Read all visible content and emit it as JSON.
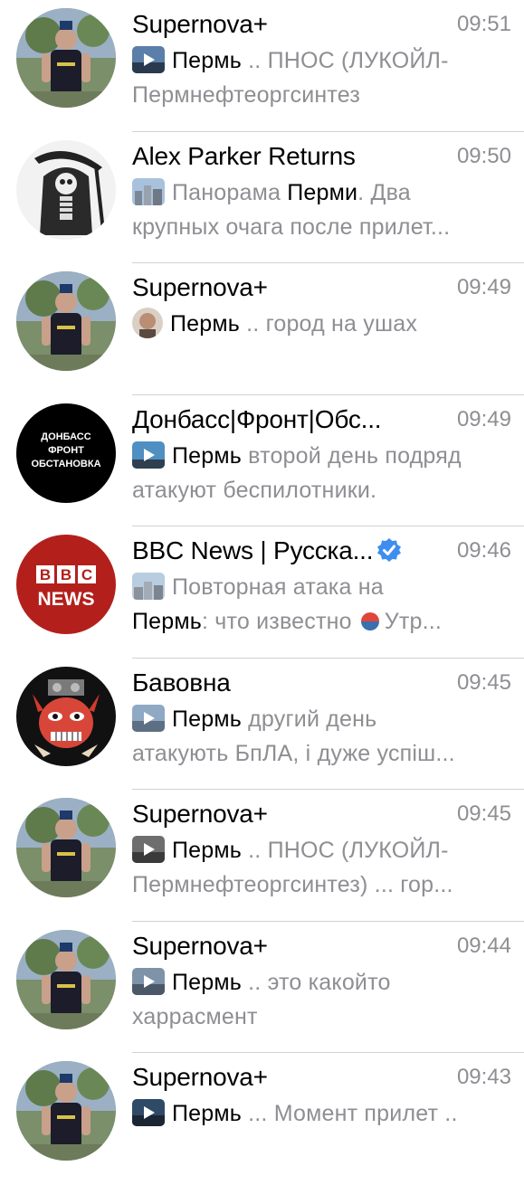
{
  "chats": [
    {
      "name": "Supernova+",
      "time": "09:51",
      "keyword": "Пермь",
      "pre": "",
      "after": " .. ПНОС (ЛУКОЙЛ-",
      "line2": "Пермнефтеоргсинтез",
      "avatar": "person",
      "thumb": "video"
    },
    {
      "name": "Alex Parker Returns",
      "time": "09:50",
      "keyword": "Перми",
      "pre": "Панорама ",
      "after": ". Два",
      "line2": "крупных очага после прилет...",
      "avatar": "reaper",
      "thumb": "city"
    },
    {
      "name": "Supernova+",
      "time": "09:49",
      "keyword": "Пермь",
      "pre": "",
      "after": " .. город на ушах",
      "line2": "",
      "avatar": "person",
      "thumb": "face"
    },
    {
      "name": "Донбасс|Фронт|Обс...",
      "time": "09:49",
      "keyword": "Пермь",
      "pre": "",
      "after": " второй день подряд",
      "line2": "атакуют беспилотники.",
      "avatar": "donbass",
      "thumb": "video"
    },
    {
      "name": "BBC News | Русска...",
      "time": "09:46",
      "keyword": "Пермь",
      "pre": "",
      "after": "",
      "line1": "Повторная атака на",
      "line2_after": ": что известно",
      "line2_tail": "Утр...",
      "verified": true,
      "avatar": "bbc",
      "thumb": "city"
    },
    {
      "name": "Бавовна",
      "time": "09:45",
      "keyword": "Пермь",
      "pre": "",
      "after": " другий день",
      "line2": "атакують БпЛА, і дуже успіш...",
      "avatar": "mask",
      "thumb": "video"
    },
    {
      "name": "Supernova+",
      "time": "09:45",
      "keyword": "Пермь",
      "pre": "",
      "after": " .. ПНОС (ЛУКОЙЛ-",
      "line2": "Пермнефтеоргсинтез) ... гор...",
      "avatar": "person",
      "thumb": "video"
    },
    {
      "name": "Supernova+",
      "time": "09:44",
      "keyword": "Пермь",
      "pre": "",
      "after": " .. это какойто",
      "line2": "харрасмент",
      "avatar": "person",
      "thumb": "video"
    },
    {
      "name": "Supernova+",
      "time": "09:43",
      "keyword": "Пермь",
      "pre": "",
      "after": " ... Момент прилет ..",
      "line2": "",
      "avatar": "person",
      "thumb": "video"
    }
  ],
  "donbass_avatar": {
    "line1": "ДОНБАСС",
    "line2": "ФРОНТ",
    "line3": "ОБСТАНОВКА"
  },
  "bbc_avatar": {
    "letters": [
      "B",
      "B",
      "C"
    ],
    "word": "NEWS"
  },
  "colors": {
    "time": "#8e8e93",
    "verified": "#3d8ef0",
    "bbc_red": "#b3201c"
  }
}
